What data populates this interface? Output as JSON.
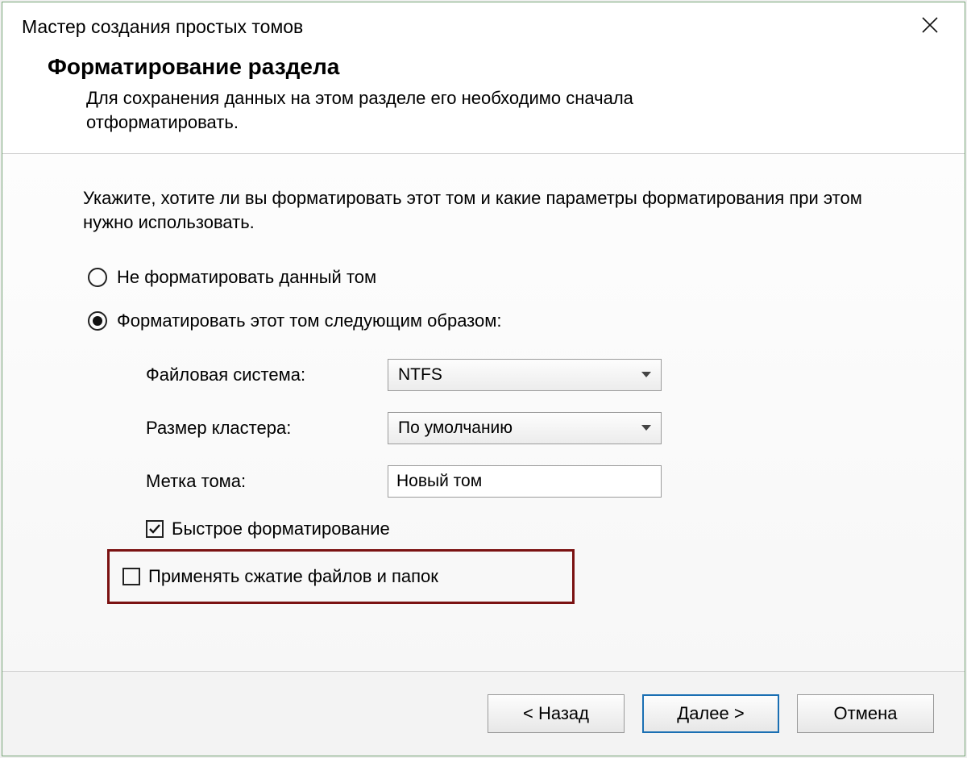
{
  "title": "Мастер создания простых томов",
  "header": {
    "heading": "Форматирование раздела",
    "subhead": "Для сохранения данных на этом разделе его необходимо сначала отформатировать."
  },
  "content": {
    "intro": "Укажите, хотите ли вы форматировать этот том и какие параметры форматирования при этом нужно использовать.",
    "radio_no_format": "Не форматировать данный том",
    "radio_format_as": "Форматировать этот том следующим образом:",
    "labels": {
      "filesystem": "Файловая система:",
      "cluster": "Размер кластера:",
      "volume_label": "Метка тома:"
    },
    "values": {
      "filesystem": "NTFS",
      "cluster": "По умолчанию",
      "volume_label": "Новый том"
    },
    "quick_format": "Быстрое форматирование",
    "compression": "Применять сжатие файлов и папок"
  },
  "footer": {
    "back": "< Назад",
    "next": "Далее >",
    "cancel": "Отмена"
  },
  "state": {
    "selected_radio": "format_as",
    "quick_format_checked": true,
    "compression_checked": false,
    "highlight_color": "#7b1212"
  }
}
